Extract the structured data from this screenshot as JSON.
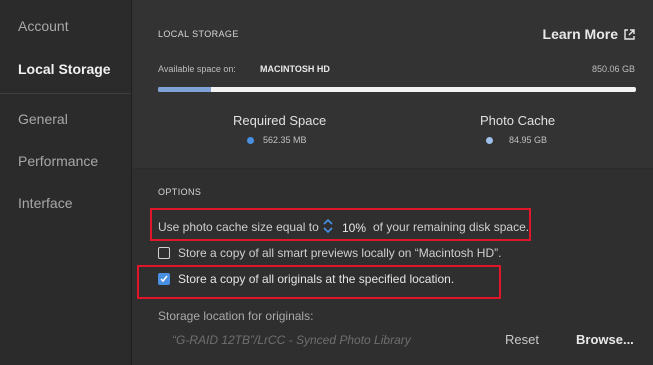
{
  "sidebar": {
    "items": [
      {
        "label": "Account"
      },
      {
        "label": "Local Storage"
      },
      {
        "label": "General"
      },
      {
        "label": "Performance"
      },
      {
        "label": "Interface"
      }
    ]
  },
  "storage": {
    "heading": "LOCAL STORAGE",
    "learn_more": "Learn More",
    "available_label": "Available space on:",
    "disk_name": "MACINTOSH HD",
    "disk_total": "850.06 GB",
    "usage_fraction": 0.11,
    "required": {
      "label": "Required Space",
      "value": "562.35 MB",
      "color": "#4a90e2"
    },
    "cache": {
      "label": "Photo Cache",
      "value": "84.95 GB",
      "color": "#9ec0ea"
    }
  },
  "options": {
    "heading": "OPTIONS",
    "cache_text_before": "Use photo cache size equal to",
    "cache_percent": "10%",
    "cache_text_after": "of your remaining disk space.",
    "smart_previews_label": "Store a copy of all smart previews locally on “Macintosh HD”.",
    "smart_previews_checked": false,
    "originals_label": "Store a copy of all originals at the specified location.",
    "originals_checked": true,
    "storage_location_label": "Storage location for originals:",
    "storage_location_value": "“G-RAID 12TB”/LrCC - Synced Photo Library",
    "reset_label": "Reset",
    "browse_label": "Browse..."
  },
  "colors": {
    "highlight_box": "#e0162b",
    "accent": "#4a90e2"
  }
}
